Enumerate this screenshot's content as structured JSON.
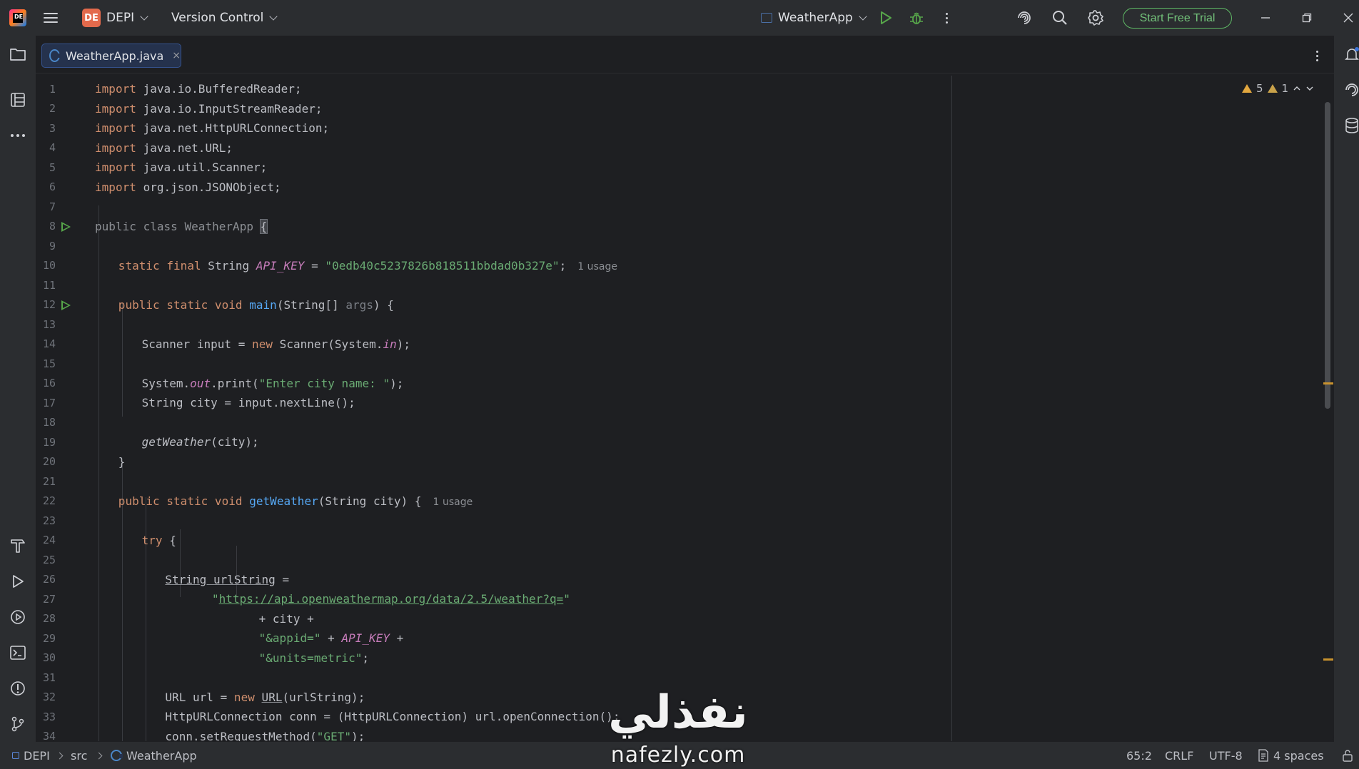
{
  "titlebar": {
    "app_logo": "DE",
    "project_badge": "DE",
    "project_name": "DEPI",
    "vcs_label": "Version Control",
    "run_config": "WeatherApp",
    "trial_label": "Start Free Trial"
  },
  "tab": {
    "label": "WeatherApp.java",
    "close": "×"
  },
  "inspections": {
    "warnings": "5",
    "weak_warnings": "1"
  },
  "lines": [
    {
      "n": "1"
    },
    {
      "n": "2"
    },
    {
      "n": "3"
    },
    {
      "n": "4"
    },
    {
      "n": "5"
    },
    {
      "n": "6"
    },
    {
      "n": "7"
    },
    {
      "n": "8"
    },
    {
      "n": "9"
    },
    {
      "n": "10"
    },
    {
      "n": "11"
    },
    {
      "n": "12"
    },
    {
      "n": "13"
    },
    {
      "n": "14"
    },
    {
      "n": "15"
    },
    {
      "n": "16"
    },
    {
      "n": "17"
    },
    {
      "n": "18"
    },
    {
      "n": "19"
    },
    {
      "n": "20"
    },
    {
      "n": "21"
    },
    {
      "n": "22"
    },
    {
      "n": "23"
    },
    {
      "n": "24"
    },
    {
      "n": "25"
    },
    {
      "n": "26"
    },
    {
      "n": "27"
    },
    {
      "n": "28"
    },
    {
      "n": "29"
    },
    {
      "n": "30"
    },
    {
      "n": "31"
    },
    {
      "n": "32"
    },
    {
      "n": "33"
    },
    {
      "n": "34"
    }
  ],
  "code": {
    "l1": [
      "import",
      " java.io.BufferedReader;"
    ],
    "l2": [
      "import",
      " java.io.InputStreamReader;"
    ],
    "l3": [
      "import",
      " java.net.HttpURLConnection;"
    ],
    "l4": [
      "import",
      " java.net.URL;"
    ],
    "l5": [
      "import",
      " java.util.Scanner;"
    ],
    "l6": [
      "import",
      " org.json.JSONObject;"
    ],
    "l8": [
      "public class WeatherApp ",
      "{"
    ],
    "l10": [
      "static final",
      " String ",
      "API_KEY",
      " = ",
      "\"0edb40c5237826b818511bbdad0b327e\"",
      ";",
      "1 usage"
    ],
    "l12": [
      "public static void",
      " ",
      "main",
      "(String[] ",
      "args",
      ") {"
    ],
    "l14": [
      "Scanner input = ",
      "new",
      " Scanner(System.",
      "in",
      ");"
    ],
    "l16": [
      "System.",
      "out",
      ".print(",
      "\"Enter city name: \"",
      ");"
    ],
    "l17": [
      "String city = input.nextLine();"
    ],
    "l19": [
      "getWeather",
      "(city);"
    ],
    "l20": [
      "}"
    ],
    "l22": [
      "public static void",
      " ",
      "getWeather",
      "(String city) {",
      "1 usage"
    ],
    "l24": [
      "try",
      " {"
    ],
    "l26": [
      "String urlString",
      " ="
    ],
    "l27": [
      "\"",
      "https://api.openweathermap.org/data/2.5/weather?q=",
      "\""
    ],
    "l28": [
      "+ city +"
    ],
    "l29": [
      "\"&appid=\"",
      " + ",
      "API_KEY",
      " +"
    ],
    "l30": [
      "\"&units=metric\"",
      ";"
    ],
    "l32": [
      "URL url = ",
      "new",
      " ",
      "URL",
      "(urlString);"
    ],
    "l33": [
      "HttpURLConnection conn = (HttpURLConnection) url.openConnection();"
    ],
    "l34": [
      "conn.setRequestMethod(",
      "\"GET\"",
      ");"
    ]
  },
  "statusbar": {
    "project": "DEPI",
    "folder": "src",
    "file": "WeatherApp",
    "position": "65:2",
    "line_sep": "CRLF",
    "encoding": "UTF-8",
    "indent": "4 spaces"
  },
  "watermark": {
    "arabic": "نفذلي",
    "latin": "nafezly.com"
  },
  "colors": {
    "keyword": "#cf8e6d",
    "string": "#6aab73",
    "constant": "#c77dbb",
    "function": "#56a8f5",
    "accent_green": "#5fb865",
    "warning": "#e2a73f"
  },
  "icons": [
    "hamburger-menu-icon",
    "run-icon",
    "debug-icon",
    "more-vertical-icon",
    "ai-assistant-icon",
    "search-icon",
    "settings-gear-icon",
    "minimize-icon",
    "restore-icon",
    "close-icon",
    "folder-icon",
    "structure-icon",
    "more-horizontal-icon",
    "build-hammer-icon",
    "run-tool-icon",
    "services-icon",
    "terminal-icon",
    "problems-icon",
    "git-icon",
    "notifications-bell-icon",
    "ai-chat-icon",
    "database-icon",
    "lock-icon"
  ]
}
